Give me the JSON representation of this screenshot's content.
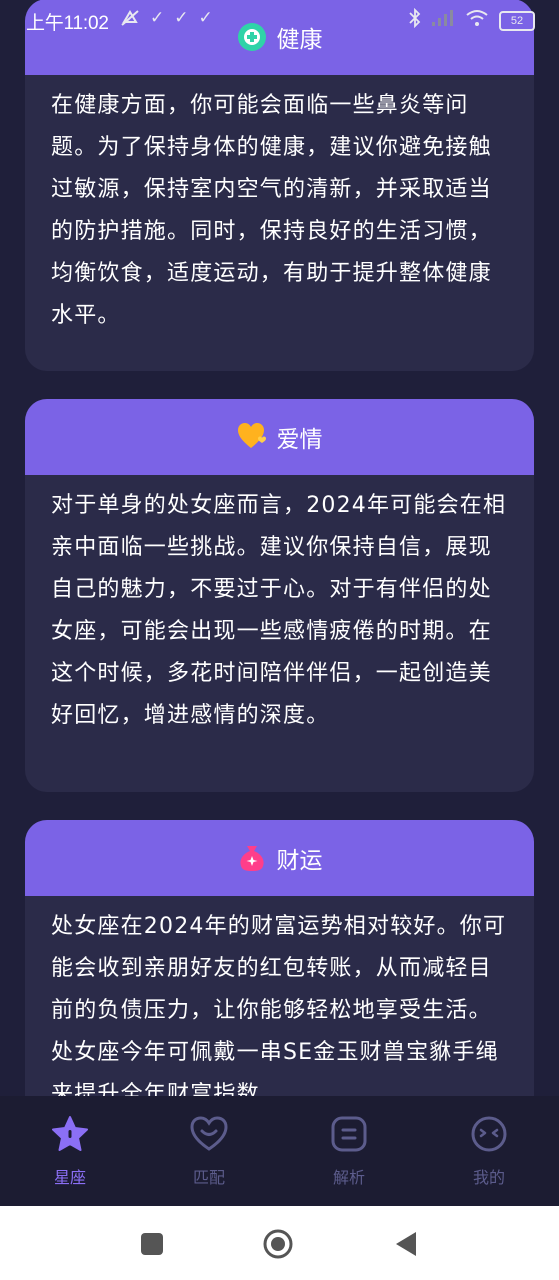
{
  "status": {
    "time": "上午11:02",
    "battery": "52"
  },
  "cards": [
    {
      "title": "健康",
      "icon": "plus-circle-icon",
      "body": "在健康方面，你可能会面临一些鼻炎等问题。为了保持身体的健康，建议你避免接触过敏源，保持室内空气的清新，并采取适当的防护措施。同时，保持良好的生活习惯，均衡饮食，适度运动，有助于提升整体健康水平。"
    },
    {
      "title": "爱情",
      "icon": "heart-icon",
      "body": "对于单身的处女座而言，2024年可能会在相亲中面临一些挑战。建议你保持自信，展现自己的魅力，不要过于心。对于有伴侣的处女座，可能会出现一些感情疲倦的时期。在这个时候，多花时间陪伴伴侣，一起创造美好回忆，增进感情的深度。"
    },
    {
      "title": "财运",
      "icon": "money-bag-icon",
      "body": "处女座在2024年的财富运势相对较好。你可能会收到亲朋好友的红包转账，从而减轻目前的负债压力，让你能够轻松地享受生活。处女座今年可佩戴一串SE金玉财兽宝貅手绳来提升全年财富指数"
    }
  ],
  "tabs": [
    {
      "label": "星座",
      "icon": "star-icon",
      "active": true
    },
    {
      "label": "匹配",
      "icon": "heart-face-icon",
      "active": false
    },
    {
      "label": "解析",
      "icon": "analysis-icon",
      "active": false
    },
    {
      "label": "我的",
      "icon": "profile-face-icon",
      "active": false
    }
  ],
  "colors": {
    "background": "#1f1f3a",
    "card": "#2b2b49",
    "card_header": "#7b63e6",
    "tab_active": "#8b6ff5",
    "tab_inactive": "#5c5c8c"
  }
}
